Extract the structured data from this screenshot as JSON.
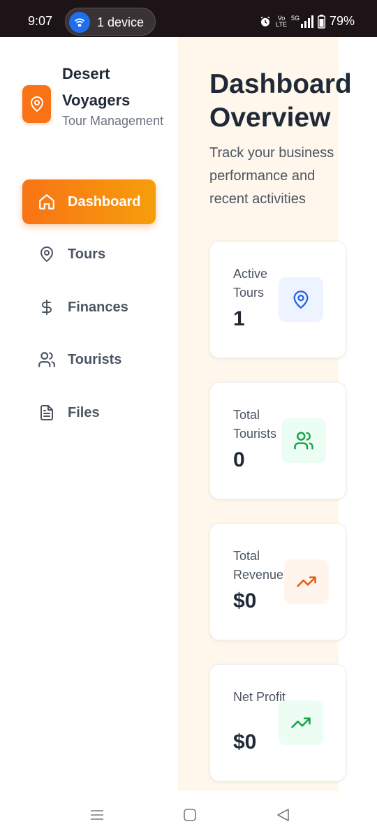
{
  "status_bar": {
    "time": "9:07",
    "pill_label": "1 device",
    "network_top": "Vo",
    "network_bottom": "LTE",
    "signal_label": "5G",
    "battery": "79%",
    "icons": [
      "hotspot-icon",
      "alarm-icon",
      "signal-icon",
      "battery-icon"
    ]
  },
  "sidebar": {
    "brand_name": "Desert Voyagers",
    "brand_sub": "Tour Management",
    "brand_icon": "map-pin-icon",
    "items": [
      {
        "label": "Dashboard",
        "icon": "home-icon",
        "active": true
      },
      {
        "label": "Tours",
        "icon": "map-pin-icon",
        "active": false
      },
      {
        "label": "Finances",
        "icon": "dollar-icon",
        "active": false
      },
      {
        "label": "Tourists",
        "icon": "users-icon",
        "active": false
      },
      {
        "label": "Files",
        "icon": "file-icon",
        "active": false
      }
    ]
  },
  "main": {
    "title": "Dashboard Overview",
    "subtitle": "Track your business performance and recent activities",
    "cards": [
      {
        "label": "Active Tours",
        "value": "1",
        "icon": "map-pin-icon",
        "accent": "#2563eb",
        "icon_bg": "#eef4ff"
      },
      {
        "label": "Total Tourists",
        "value": "0",
        "icon": "users-icon",
        "accent": "#16a34a",
        "icon_bg": "#ecfdf3"
      },
      {
        "label": "Total Revenue",
        "value": "$0",
        "icon": "trending-up-icon",
        "accent": "#ea580c",
        "icon_bg": "#fff5ec"
      },
      {
        "label": "Net Profit",
        "value": "$0",
        "icon": "trending-up-icon",
        "accent": "#16a34a",
        "icon_bg": "#ecfdf3"
      }
    ]
  },
  "colors": {
    "brand": "#f97316",
    "main_bg": "#fff7eb"
  },
  "system_nav": {
    "icons": [
      "menu-icon",
      "home-square-icon",
      "back-icon"
    ]
  }
}
